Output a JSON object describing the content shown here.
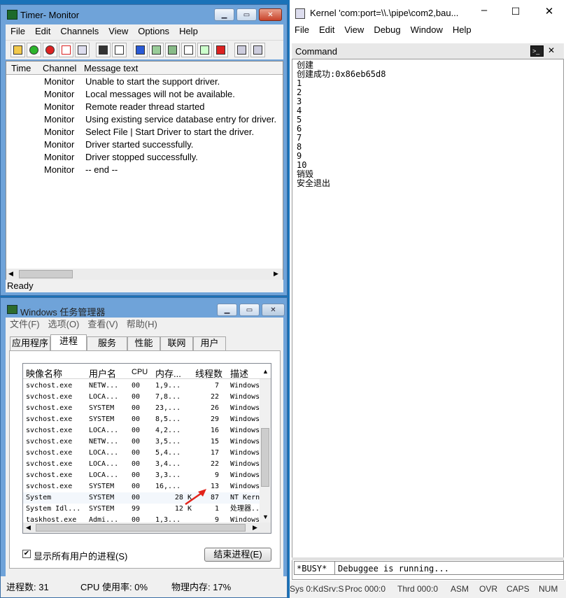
{
  "timer_monitor": {
    "title": "Timer- Monitor",
    "menu": [
      "File",
      "Edit",
      "Channels",
      "View",
      "Options",
      "Help"
    ],
    "columns": [
      "Time",
      "Channel",
      "Message text"
    ],
    "rows": [
      {
        "channel": "Monitor",
        "message": "Unable to start the support driver."
      },
      {
        "channel": "Monitor",
        "message": "Local messages will not be available."
      },
      {
        "channel": "Monitor",
        "message": "Remote reader thread started"
      },
      {
        "channel": "Monitor",
        "message": "Using existing service database entry for driver."
      },
      {
        "channel": "Monitor",
        "message": "Select File | Start Driver to start the driver."
      },
      {
        "channel": "Monitor",
        "message": "Driver started successfully."
      },
      {
        "channel": "Monitor",
        "message": "Driver stopped successfully."
      },
      {
        "channel": "Monitor",
        "message": " -- end --"
      }
    ],
    "status": "Ready"
  },
  "kernel": {
    "title": "Kernel 'com:port=\\\\.\\pipe\\com2,bau...",
    "menu": [
      "File",
      "Edit",
      "View",
      "Debug",
      "Window",
      "Help"
    ],
    "command_title": "Command",
    "output": "创建\n创建成功:0x86eb65d8\n1\n2\n3\n4\n5\n6\n7\n8\n9\n10\n销毁\n安全退出",
    "busy_label": "*BUSY*",
    "input_text": "Debuggee is running...",
    "statusbar": [
      "Sys 0:KdSrv:S",
      "Proc 000:0",
      "Thrd 000:0",
      "ASM",
      "OVR",
      "CAPS",
      "NUM"
    ]
  },
  "task_manager": {
    "title": "Windows 任务管理器",
    "menu": [
      "文件(F)",
      "选项(O)",
      "查看(V)",
      "帮助(H)"
    ],
    "tabs": [
      "应用程序",
      "进程",
      "服务",
      "性能",
      "联网",
      "用户"
    ],
    "columns": [
      "映像名称",
      "用户名",
      "CPU",
      "内存...",
      "线程数",
      "描述"
    ],
    "processes": [
      {
        "name": "svchost.exe",
        "user": "NETW...",
        "cpu": "00",
        "mem": "1,9...",
        "threads": "7",
        "desc": "Windows"
      },
      {
        "name": "svchost.exe",
        "user": "LOCA...",
        "cpu": "00",
        "mem": "7,8...",
        "threads": "22",
        "desc": "Windows"
      },
      {
        "name": "svchost.exe",
        "user": "SYSTEM",
        "cpu": "00",
        "mem": "23,...",
        "threads": "26",
        "desc": "Windows"
      },
      {
        "name": "svchost.exe",
        "user": "SYSTEM",
        "cpu": "00",
        "mem": "8,5...",
        "threads": "29",
        "desc": "Windows"
      },
      {
        "name": "svchost.exe",
        "user": "LOCA...",
        "cpu": "00",
        "mem": "4,2...",
        "threads": "16",
        "desc": "Windows"
      },
      {
        "name": "svchost.exe",
        "user": "NETW...",
        "cpu": "00",
        "mem": "3,5...",
        "threads": "15",
        "desc": "Windows"
      },
      {
        "name": "svchost.exe",
        "user": "LOCA...",
        "cpu": "00",
        "mem": "5,4...",
        "threads": "17",
        "desc": "Windows"
      },
      {
        "name": "svchost.exe",
        "user": "LOCA...",
        "cpu": "00",
        "mem": "3,4...",
        "threads": "22",
        "desc": "Windows"
      },
      {
        "name": "svchost.exe",
        "user": "LOCA...",
        "cpu": "00",
        "mem": "3,3...",
        "threads": "9",
        "desc": "Windows"
      },
      {
        "name": "svchost.exe",
        "user": "SYSTEM",
        "cpu": "00",
        "mem": "16,...",
        "threads": "13",
        "desc": "Windows"
      },
      {
        "name": "System",
        "user": "SYSTEM",
        "cpu": "00",
        "mem": "28 K",
        "threads": "87",
        "desc": "NT Kern"
      },
      {
        "name": "System Idl...",
        "user": "SYSTEM",
        "cpu": "99",
        "mem": "12 K",
        "threads": "1",
        "desc": "处理器..."
      },
      {
        "name": "taskhost.exe",
        "user": "Admi...",
        "cpu": "00",
        "mem": "1,3...",
        "threads": "9",
        "desc": "Windows"
      }
    ],
    "show_all_label": "显示所有用户的进程(S)",
    "end_button": "结束进程(E)",
    "status": {
      "procs": "进程数: 31",
      "cpu": "CPU 使用率: 0%",
      "mem": "物理内存: 17%"
    }
  }
}
